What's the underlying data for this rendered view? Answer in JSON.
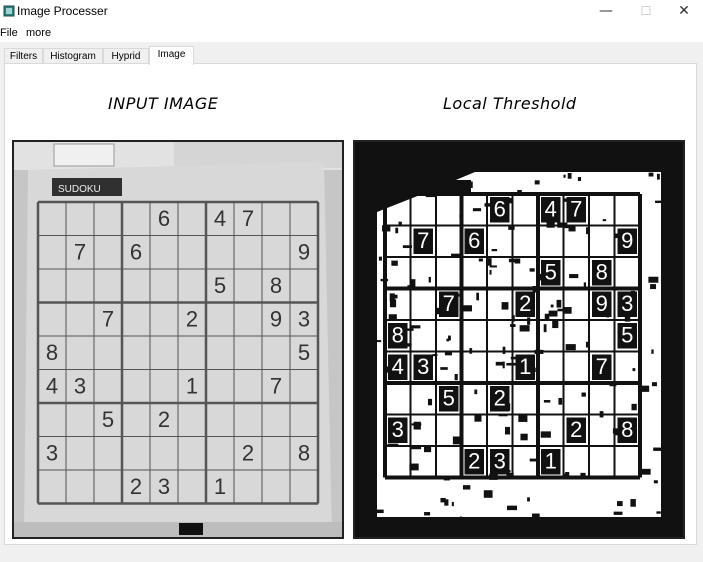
{
  "window": {
    "title": "Image Processer",
    "icon": "app-image-icon",
    "controls": {
      "minimize": "—",
      "maximize": "☐",
      "close": "✕"
    }
  },
  "menu": {
    "items": [
      "File",
      "more"
    ]
  },
  "tabs": [
    {
      "label": "Filters",
      "active": false
    },
    {
      "label": "Histogram",
      "active": false
    },
    {
      "label": "Hyprid",
      "active": false
    },
    {
      "label": "Image",
      "active": true
    }
  ],
  "main": {
    "input_title": "INPUT IMAGE",
    "output_title": "Local Threshold",
    "input_image": {
      "banner": "SUDOKU",
      "digits": [
        {
          "r": 0,
          "c": 4,
          "v": "6"
        },
        {
          "r": 0,
          "c": 6,
          "v": "4"
        },
        {
          "r": 0,
          "c": 7,
          "v": "7"
        },
        {
          "r": 1,
          "c": 1,
          "v": "7"
        },
        {
          "r": 1,
          "c": 3,
          "v": "6"
        },
        {
          "r": 1,
          "c": 9,
          "v": "9"
        },
        {
          "r": 2,
          "c": 6,
          "v": "5"
        },
        {
          "r": 2,
          "c": 8,
          "v": "8"
        },
        {
          "r": 3,
          "c": 2,
          "v": "7"
        },
        {
          "r": 3,
          "c": 5,
          "v": "2"
        },
        {
          "r": 3,
          "c": 8,
          "v": "9"
        },
        {
          "r": 3,
          "c": 9,
          "v": "3"
        },
        {
          "r": 4,
          "c": 0,
          "v": "8"
        },
        {
          "r": 4,
          "c": 9,
          "v": "5"
        },
        {
          "r": 5,
          "c": 0,
          "v": "4"
        },
        {
          "r": 5,
          "c": 1,
          "v": "3"
        },
        {
          "r": 5,
          "c": 5,
          "v": "1"
        },
        {
          "r": 5,
          "c": 8,
          "v": "7"
        },
        {
          "r": 6,
          "c": 2,
          "v": "5"
        },
        {
          "r": 6,
          "c": 4,
          "v": "2"
        },
        {
          "r": 7,
          "c": 0,
          "v": "3"
        },
        {
          "r": 7,
          "c": 7,
          "v": "2"
        },
        {
          "r": 7,
          "c": 9,
          "v": "8"
        },
        {
          "r": 8,
          "c": 3,
          "v": "2"
        },
        {
          "r": 8,
          "c": 4,
          "v": "3"
        },
        {
          "r": 8,
          "c": 6,
          "v": "1"
        }
      ]
    }
  }
}
